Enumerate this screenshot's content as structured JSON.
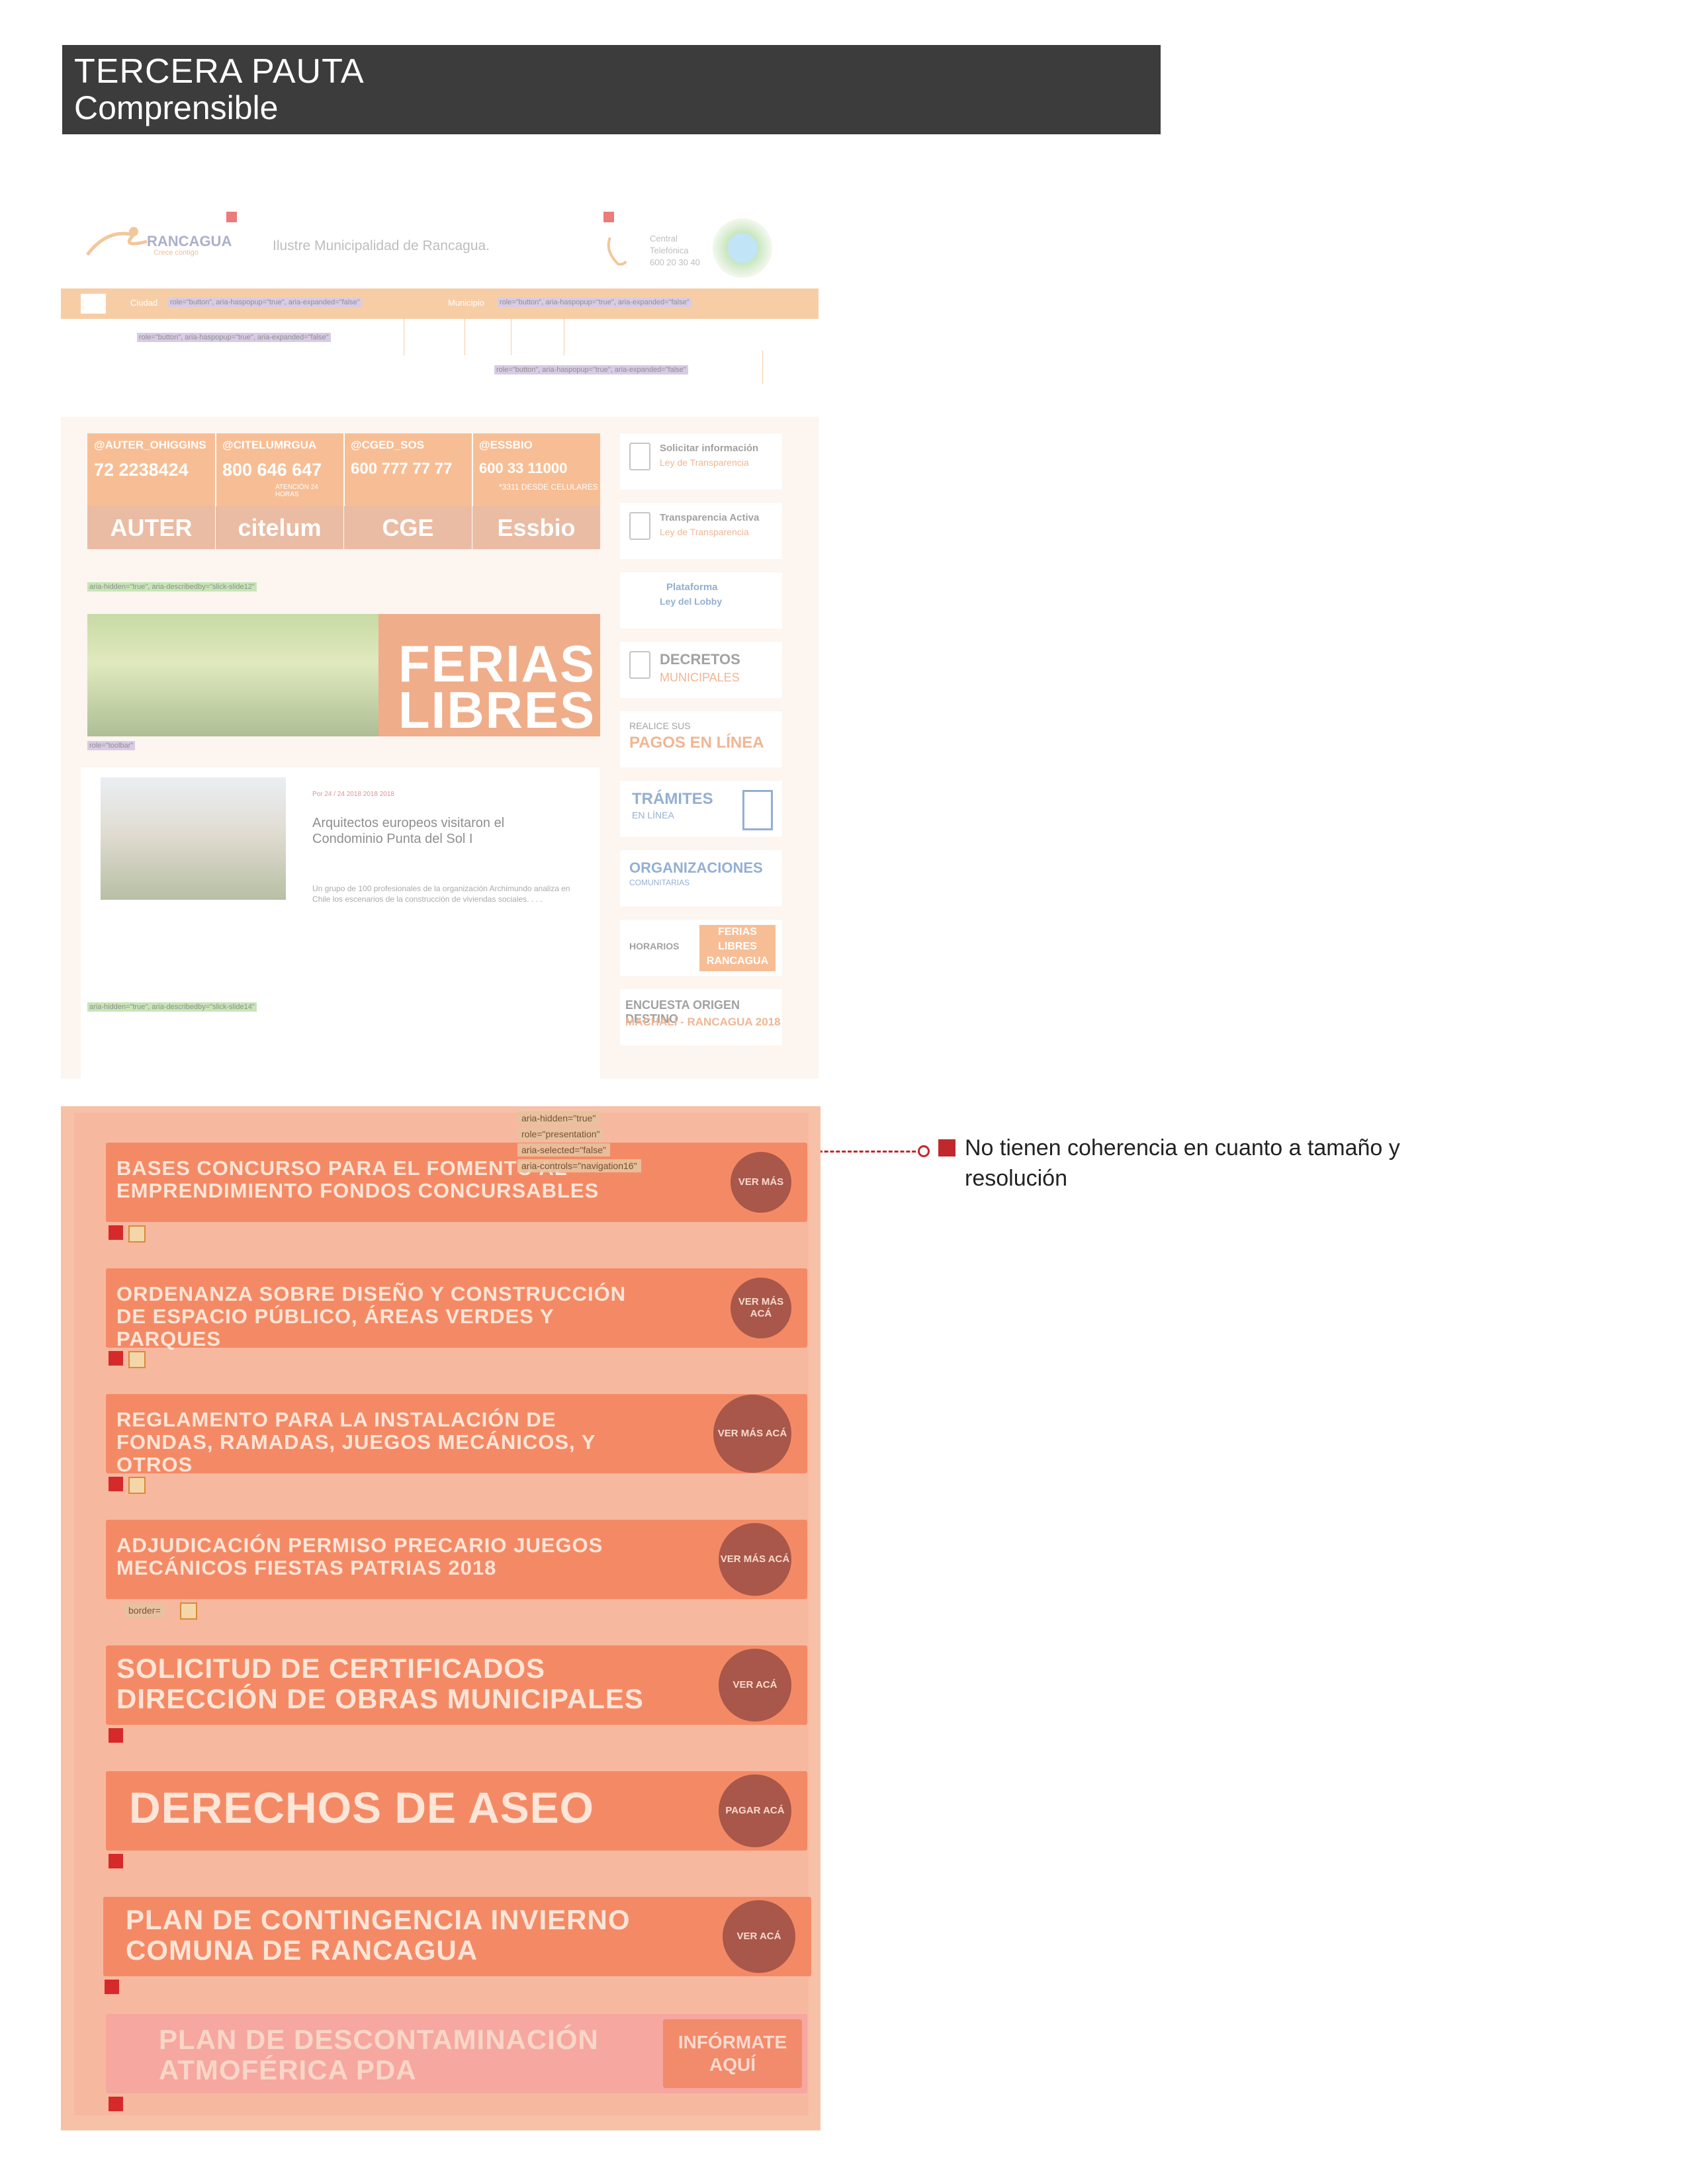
{
  "heading": {
    "title": "TERCERA PAUTA",
    "subtitle": "Comprensible"
  },
  "site": {
    "logo_word": "RANCAGUA",
    "logo_sub": "Crece contigo",
    "municipality": "Ilustre Municipalidad de Rancagua.",
    "phone_label": "Central Telefónica",
    "phone_number": "600 20 30 40",
    "nav": {
      "item1": "Ciudad",
      "item2": "Municipio"
    },
    "aria_button": "role=\"button\", aria-haspopup=\"true\", aria-expanded=\"false\"",
    "aria_hidden": "aria-hidden=\"true\", aria-describedby=\"slick-slide12\"",
    "aria_hidden2": "aria-hidden=\"true\", aria-describedby=\"slick-slide14\"",
    "aria_toolbar": "role=\"toolbar\"",
    "banner": [
      {
        "twitter": "@AUTER_OHIGGINS",
        "phone": "72 2238424",
        "sub": "",
        "brand": "AUTER"
      },
      {
        "twitter": "@CITELUMRGUA",
        "phone": "800 646 647",
        "sub": "ATENCIÓN 24 HORAS",
        "brand": "citelum"
      },
      {
        "twitter": "@CGED_SOS",
        "phone": "600 777 77 77",
        "sub": "",
        "brand": "CGE"
      },
      {
        "twitter": "@ESSBIO",
        "phone": "600 33 11000",
        "sub": "*3311 DESDE CELULARES",
        "brand": "Essbio"
      }
    ],
    "ferias_title": "FERIAS LIBRES",
    "news": {
      "date": "Por 24 / 24 2018 2018 2018",
      "title": "Arquitectos europeos visitaron el Condominio Punta del Sol I",
      "excerpt": "Un grupo de 100 profesionales de la organización Archimundo analiza en Chile los escenarios de la construcción de viviendas sociales. . . ."
    },
    "sidebar": [
      {
        "l1": "Solicitar información",
        "l2": "Ley de Transparencia"
      },
      {
        "l1": "Transparencia Activa",
        "l2": "Ley de Transparencia"
      },
      {
        "l1": "Plataforma",
        "l2": "Ley del Lobby"
      },
      {
        "l1": "DECRETOS",
        "l2": "MUNICIPALES"
      },
      {
        "l1": "REALICE SUS",
        "l2": "PAGOS EN LÍNEA"
      },
      {
        "l1": "TRÁMITES",
        "l2": "EN LÍNEA"
      },
      {
        "l1": "ORGANIZACIONES",
        "l2": "COMUNITARIAS"
      },
      {
        "l1": "HORARIOS",
        "l2": "FERIAS LIBRES RANCAGUA"
      },
      {
        "l1": "ENCUESTA ORIGEN DESTINO",
        "l2": "MACHALÍ - RANCAGUA 2018"
      }
    ]
  },
  "annotation": {
    "text": "No tienen coherencia en cuanto a tamaño y resolución"
  },
  "cards": [
    {
      "title": "BASES CONCURSO PARA EL FOMENTO AL EMPRENDIMIENTO FONDOS CONCURSABLES",
      "button": "VER MÁS"
    },
    {
      "title": "ORDENANZA SOBRE DISEÑO Y CONSTRUCCIÓN DE ESPACIO PÚBLICO, ÁREAS VERDES Y PARQUES",
      "button": "VER MÁS ACÁ"
    },
    {
      "title": "REGLAMENTO PARA LA INSTALACIÓN DE FONDAS, RAMADAS, JUEGOS MECÁNICOS, Y OTROS",
      "button": "VER MÁS ACÁ"
    },
    {
      "title": "ADJUDICACIÓN PERMISO PRECARIO JUEGOS MECÁNICOS FIESTAS PATRIAS 2018",
      "button": "VER MÁS ACÁ"
    },
    {
      "title": "SOLICITUD DE CERTIFICADOS DIRECCIÓN DE OBRAS MUNICIPALES",
      "button": "VER ACÁ"
    },
    {
      "title": "DERECHOS DE ASEO",
      "button": "PAGAR ACÁ"
    },
    {
      "title": "PLAN DE CONTINGENCIA INVIERNO COMUNA DE RANCAGUA",
      "button": "VER ACÁ"
    },
    {
      "title": "PLAN DE DESCONTAMINACIÓN ATMOFÉRICA PDA",
      "button": "INFÓRMATE AQUÍ"
    }
  ],
  "overlay_tags": {
    "tag1": "aria-hidden=\"true\" ",
    "tag2": "role=\"presentation\"",
    "tag3": "aria-selected=\"false\"",
    "tag4": "aria-controls=\"navigation16\"",
    "tag5": "border="
  }
}
